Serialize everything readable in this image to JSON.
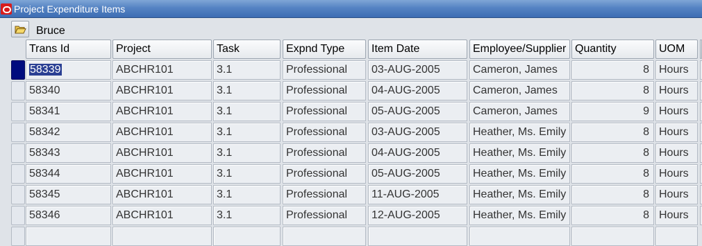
{
  "window": {
    "title": "Project Expenditure Items"
  },
  "folder": {
    "name": "Bruce"
  },
  "columns": {
    "trans_id": "Trans Id",
    "project": "Project",
    "task": "Task",
    "expnd_type": "Expnd Type",
    "item_date": "Item Date",
    "employee": "Employee/Supplier",
    "quantity": "Quantity",
    "uom": "UOM"
  },
  "rows": [
    {
      "trans_id": "58339",
      "project": "ABCHR101",
      "task": "3.1",
      "expnd_type": "Professional",
      "item_date": "03-AUG-2005",
      "employee": "Cameron, James",
      "quantity": "8",
      "uom": "Hours",
      "selected": true
    },
    {
      "trans_id": "58340",
      "project": "ABCHR101",
      "task": "3.1",
      "expnd_type": "Professional",
      "item_date": "04-AUG-2005",
      "employee": "Cameron, James",
      "quantity": "8",
      "uom": "Hours"
    },
    {
      "trans_id": "58341",
      "project": "ABCHR101",
      "task": "3.1",
      "expnd_type": "Professional",
      "item_date": "05-AUG-2005",
      "employee": "Cameron, James",
      "quantity": "9",
      "uom": "Hours"
    },
    {
      "trans_id": "58342",
      "project": "ABCHR101",
      "task": "3.1",
      "expnd_type": "Professional",
      "item_date": "03-AUG-2005",
      "employee": "Heather, Ms. Emily",
      "quantity": "8",
      "uom": "Hours"
    },
    {
      "trans_id": "58343",
      "project": "ABCHR101",
      "task": "3.1",
      "expnd_type": "Professional",
      "item_date": "04-AUG-2005",
      "employee": "Heather, Ms. Emily",
      "quantity": "8",
      "uom": "Hours"
    },
    {
      "trans_id": "58344",
      "project": "ABCHR101",
      "task": "3.1",
      "expnd_type": "Professional",
      "item_date": "05-AUG-2005",
      "employee": "Heather, Ms. Emily",
      "quantity": "8",
      "uom": "Hours"
    },
    {
      "trans_id": "58345",
      "project": "ABCHR101",
      "task": "3.1",
      "expnd_type": "Professional",
      "item_date": "11-AUG-2005",
      "employee": "Heather, Ms. Emily",
      "quantity": "8",
      "uom": "Hours"
    },
    {
      "trans_id": "58346",
      "project": "ABCHR101",
      "task": "3.1",
      "expnd_type": "Professional",
      "item_date": "12-AUG-2005",
      "employee": "Heather, Ms. Emily",
      "quantity": "8",
      "uom": "Hours"
    }
  ],
  "colors": {
    "titlebar": "#5583c3",
    "selection": "#2a3f93",
    "current_record": "#000c7e"
  }
}
